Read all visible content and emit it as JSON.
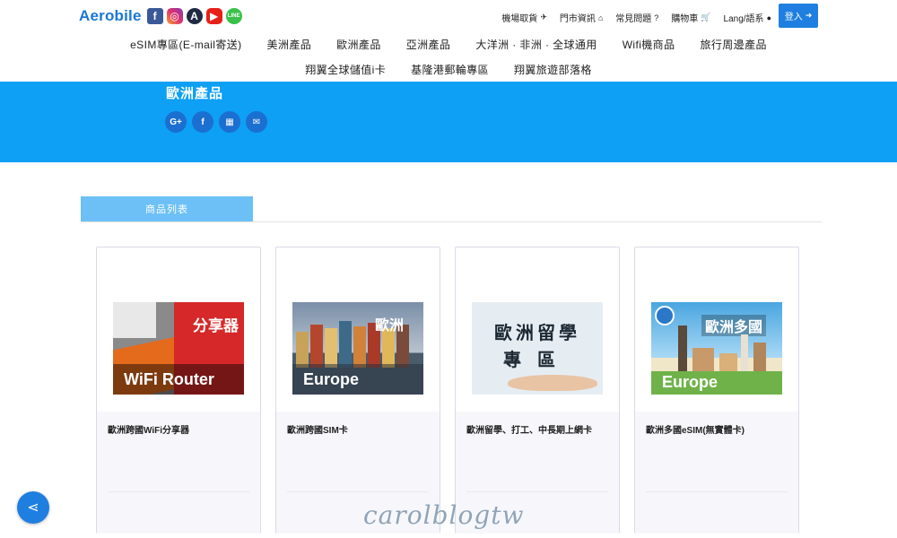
{
  "header": {
    "logo": "Aerobile",
    "social_icons": [
      "facebook-icon",
      "instagram-icon",
      "tw-icon",
      "youtube-icon",
      "line-icon"
    ],
    "social_glyphs": [
      "f",
      "◎",
      "A",
      "▶",
      "LINE"
    ],
    "top_links": [
      {
        "label": "機場取貨",
        "icon": "plane-icon",
        "glyph": "✈"
      },
      {
        "label": "門市資訊",
        "icon": "home-icon",
        "glyph": "⌂"
      },
      {
        "label": "常見問題",
        "icon": "question-icon",
        "glyph": "?"
      },
      {
        "label": "購物車",
        "icon": "cart-icon",
        "glyph": "🛒"
      },
      {
        "label": "Lang/語系",
        "icon": "globe-icon",
        "glyph": "●"
      }
    ],
    "login": {
      "label": "登入",
      "glyph": "➜"
    }
  },
  "nav": {
    "row1": [
      "eSIM專區(E-mail寄送)",
      "美洲產品",
      "歐洲產品",
      "亞洲產品",
      "大洋洲 · 非洲 · 全球通用",
      "Wifi機商品",
      "旅行周邊產品"
    ],
    "row2": [
      "翔翼全球儲值i卡",
      "基隆港郵輪專區",
      "翔翼旅遊部落格"
    ]
  },
  "banner": {
    "title": "歐洲產品",
    "share_icons": [
      {
        "name": "google-plus-icon",
        "glyph": "G+"
      },
      {
        "name": "facebook-share-icon",
        "glyph": "f"
      },
      {
        "name": "qrcode-icon",
        "glyph": "▦"
      },
      {
        "name": "email-icon",
        "glyph": "✉"
      }
    ]
  },
  "tabs": {
    "active": "商品列表"
  },
  "products": [
    {
      "name": "歐洲跨國WiFi分享器",
      "image_tag": "分享器",
      "image_label": "WiFi Router"
    },
    {
      "name": "歐洲跨國SIM卡",
      "image_tag": "歐洲",
      "image_label": "Europe"
    },
    {
      "name": "歐洲留學、打工、中長期上網卡",
      "image_line1": "歐洲留學",
      "image_line2": "專區"
    },
    {
      "name": "歐洲多國eSIM(無實體卡)",
      "image_tag": "歐洲多國",
      "image_label": "Europe"
    }
  ],
  "float_share": {
    "glyph": "⋖"
  },
  "watermark": "carolblogtw",
  "colors": {
    "brand": "#1e7fe0",
    "banner": "#0da0f5",
    "tab": "#6cc0f6"
  }
}
